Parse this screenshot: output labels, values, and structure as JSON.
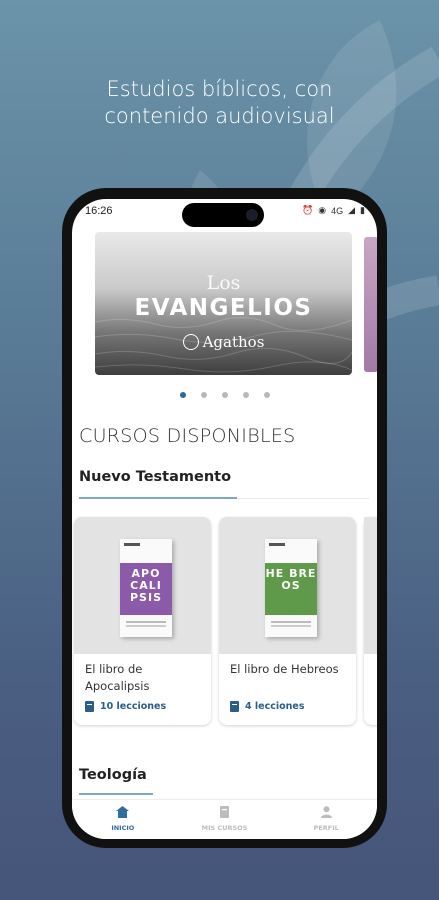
{
  "promo": {
    "line1": "Estudios bíblicos, con",
    "line2": "contenido audiovisual"
  },
  "status_bar": {
    "time": "16:26",
    "network": "4G"
  },
  "carousel": {
    "banner_subtitle": "Los",
    "banner_title": "EVANGELIOS",
    "banner_brand": "Agathos",
    "page_count": 5,
    "active_index": 0
  },
  "section": {
    "title": "CURSOS DISPONIBLES"
  },
  "categories": [
    {
      "label": "Nuevo Testamento",
      "courses": [
        {
          "title": "El libro de Apocalipsis",
          "lessons": "10 lecciones",
          "cover_text": "APO CALI PSIS",
          "cover_color": "#8b5aa8"
        },
        {
          "title": "El libro de Hebreos",
          "lessons": "4 lecciones",
          "cover_text": "HE BRE OS",
          "cover_color": "#5e9a4a"
        }
      ]
    },
    {
      "label": "Teología"
    }
  ],
  "bottom_nav": {
    "items": [
      {
        "label": "INICIO",
        "icon": "home-icon",
        "active": true
      },
      {
        "label": "MIS CURSOS",
        "icon": "book-icon",
        "active": false
      },
      {
        "label": "PERFIL",
        "icon": "user-icon",
        "active": false
      }
    ]
  },
  "colors": {
    "accent": "#2f6fa0",
    "underline": "#7aa9c7",
    "background_top": "#6b93a9",
    "background_bottom": "#46557a"
  }
}
